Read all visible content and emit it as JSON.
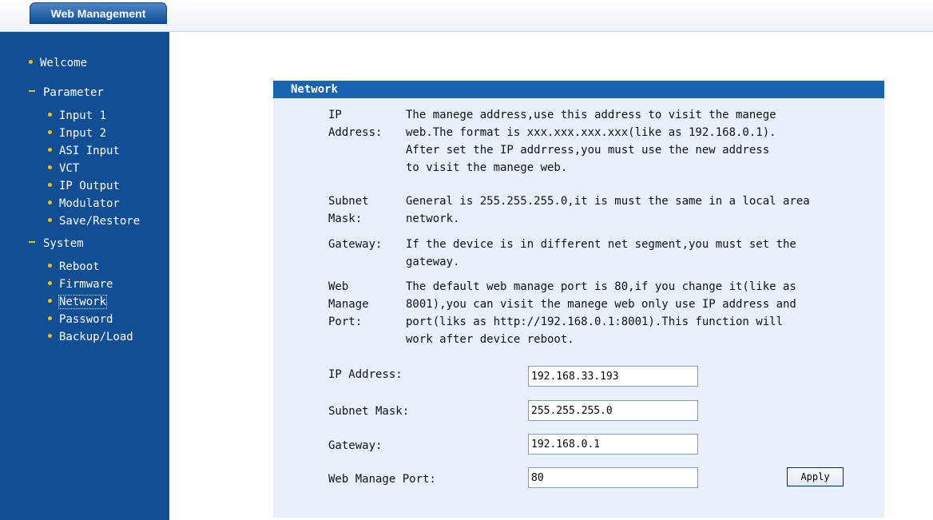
{
  "header": {
    "brand": "Web Management"
  },
  "sidebar": {
    "welcome": "Welcome",
    "parameter": "Parameter",
    "parameter_items": [
      "Input 1",
      "Input 2",
      "ASI Input",
      "VCT",
      "IP Output",
      "Modulator",
      "Save/Restore"
    ],
    "system": "System",
    "system_items": [
      "Reboot",
      "Firmware",
      "Network",
      "Password",
      "Backup/Load"
    ],
    "selected": "Network"
  },
  "panel": {
    "title": "Network",
    "help": [
      {
        "label_lines": [
          "IP",
          "Address:"
        ],
        "text_lines": [
          "The manege address,use this address to visit the manege",
          "web.The format is xxx.xxx.xxx.xxx(like as 192.168.0.1).",
          "After set the IP addrress,you must use the new address",
          "to visit the manege web."
        ]
      },
      {
        "label_lines": [
          "Subnet",
          "Mask:"
        ],
        "text_lines": [
          "General is 255.255.255.0,it is must the same in a local area",
          "network."
        ]
      },
      {
        "label_lines": [
          "Gateway:"
        ],
        "text_lines": [
          "If the device is in different net segment,you must set the",
          "gateway."
        ]
      },
      {
        "label_lines": [
          "Web",
          "Manage",
          "Port:"
        ],
        "text_lines": [
          "The default web manage port is 80,if you change it(like as",
          "8001),you can visit the manege web only use IP address and",
          "port(liks as http://192.168.0.1:8001).This function will",
          "work after device reboot."
        ]
      }
    ],
    "form": {
      "ip_label": "IP Address:",
      "ip_value": "192.168.33.193",
      "subnet_label": "Subnet Mask:",
      "subnet_value": "255.255.255.0",
      "gateway_label": "Gateway:",
      "gateway_value": "192.168.0.1",
      "port_label": "Web Manage Port:",
      "port_value": "80",
      "apply_label": "Apply"
    }
  },
  "colors": {
    "sidebar_bg": "#124e96",
    "header_bar": "#1864b0",
    "panel_bg": "#e8f1fb",
    "bullet": "#f2c200"
  }
}
